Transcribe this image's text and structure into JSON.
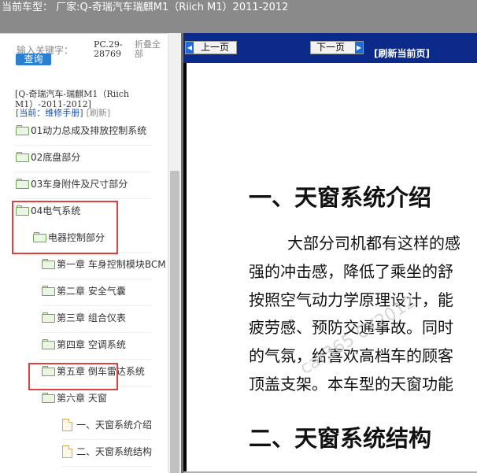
{
  "window": {
    "title": "当前车型： 厂家:Q-奇瑞汽车瑞麒M1（Riich M1）2011-2012"
  },
  "sidebar": {
    "keyword_placeholder": "输入关键字：",
    "search_label": "查询",
    "code": "PC.29-28769",
    "collapse_label": "折叠全部",
    "model": "[Q-奇瑞汽车-瑞麒M1（Riich M1）-2011-2012]",
    "current": "[当前：维修手册]",
    "refresh_label": "[刷新]",
    "tree": [
      {
        "label": "01动力总成及排放控制系统",
        "type": "folder"
      },
      {
        "label": "02底盘部分",
        "type": "folder"
      },
      {
        "label": "03车身附件及尺寸部分",
        "type": "folder"
      },
      {
        "label": "04电气系统",
        "type": "folder",
        "highlighted": true
      },
      {
        "label": "电器控制部分",
        "type": "folder",
        "highlighted": true
      },
      {
        "label": "第一章 车身控制模块BCM",
        "type": "folder"
      },
      {
        "label": "第二章 安全气囊",
        "type": "folder"
      },
      {
        "label": "第三章 组合仪表",
        "type": "folder"
      },
      {
        "label": "第四章 空调系统",
        "type": "folder"
      },
      {
        "label": "第五章 倒车雷达系统",
        "type": "folder"
      },
      {
        "label": "第六章 天窗",
        "type": "folder",
        "highlighted": true
      },
      {
        "label": "一、天窗系统介绍",
        "type": "document"
      },
      {
        "label": "二、天窗系统结构",
        "type": "document"
      }
    ]
  },
  "viewer": {
    "prev_label": "上一页",
    "next_label": "下一页",
    "refresh_label": "[刷新当前页]",
    "heading1": "一、天窗系统介绍",
    "paragraph_lines": [
      "大部分司机都有这样的感",
      "强的冲击感，降低了乘坐的舒",
      "按照空气动力学原理设计，能",
      "疲劳感、预防交通事故。同时",
      "的气氛，给喜欢高档车的顾客",
      "顶盖支架。本车型的天窗功能"
    ],
    "heading2": "二、天窗系统结构",
    "watermark": "car365 CY2012"
  },
  "colors": {
    "titlebar": "#8a8a8a",
    "toolbar": "#0b2a8a",
    "highlight": "#e0403e",
    "folder": "#6aa84f",
    "document": "#e8a44a",
    "search_button": "#2a7fd0"
  }
}
